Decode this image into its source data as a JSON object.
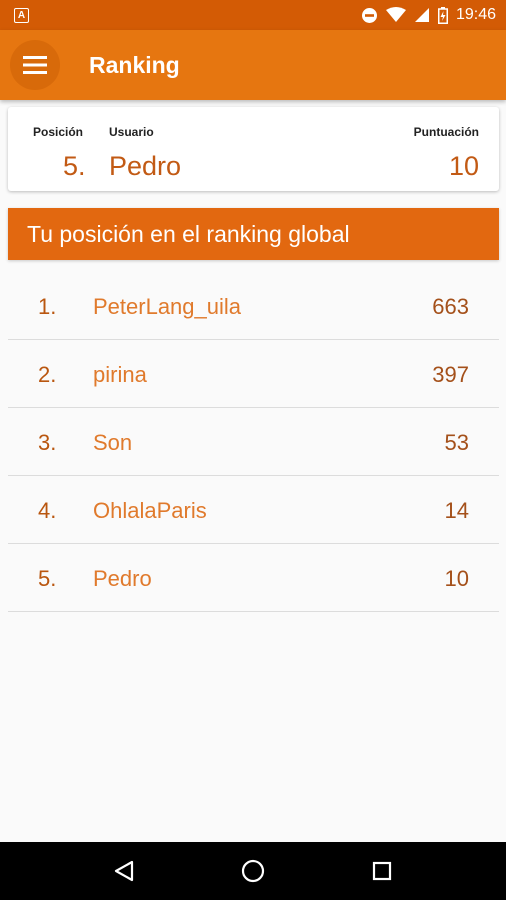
{
  "status_bar": {
    "notification_icon": "a-box-icon",
    "time": "19:46",
    "color": "#d35b05"
  },
  "app_bar": {
    "title": "Ranking",
    "menu_icon": "hamburger-menu-icon",
    "color": "#e67610"
  },
  "user_card": {
    "position_label": "Posición",
    "user_label": "Usuario",
    "score_label": "Puntuación",
    "position": "5.",
    "user": "Pedro",
    "score": "10"
  },
  "section": {
    "title": "Tu posición en el ranking global",
    "color": "#e26810"
  },
  "ranking": [
    {
      "pos": "1.",
      "user": "PeterLang_uila",
      "score": "663"
    },
    {
      "pos": "2.",
      "user": "pirina",
      "score": "397"
    },
    {
      "pos": "3.",
      "user": "Son",
      "score": "53"
    },
    {
      "pos": "4.",
      "user": "OhlalaParis",
      "score": "14"
    },
    {
      "pos": "5.",
      "user": "Pedro",
      "score": "10"
    }
  ],
  "nav_bar": {
    "back_icon": "back-triangle-icon",
    "home_icon": "home-circle-icon",
    "recents_icon": "recents-square-icon"
  }
}
